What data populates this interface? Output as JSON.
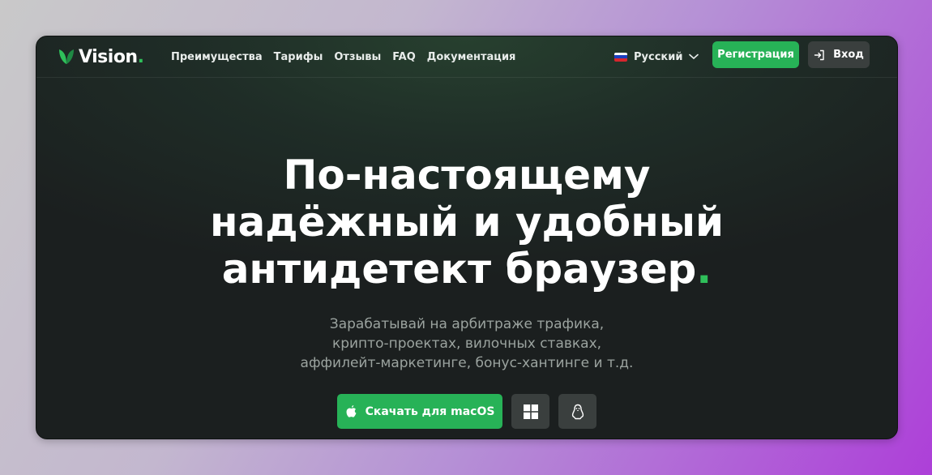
{
  "brand": {
    "name": "Vision",
    "dot": ".",
    "accent_color": "#2fbf5a"
  },
  "nav": {
    "links": [
      {
        "label": "Преимущества"
      },
      {
        "label": "Тарифы"
      },
      {
        "label": "Отзывы"
      },
      {
        "label": "FAQ"
      },
      {
        "label": "Документация"
      }
    ],
    "language": {
      "label": "Русский",
      "flag_icon": "russia-flag-icon"
    },
    "register_label": "Регистрация",
    "login_label": "Вход"
  },
  "hero": {
    "title_line1": "По-настоящему",
    "title_line2": "надёжный и удобный",
    "title_line3": "антидетект браузер",
    "title_dot": ".",
    "subtitle_line1": "Зарабатывай на арбитраже трафика,",
    "subtitle_line2": "крипто-проектах, вилочных ставках,",
    "subtitle_line3": "аффилейт-маркетинге, бонус-хантинге и т.д.",
    "download_label": "Скачать для macOS"
  },
  "colors": {
    "primary_green": "#27b257",
    "dark_button": "#3a3f3e",
    "subtitle": "#9ba39f"
  }
}
